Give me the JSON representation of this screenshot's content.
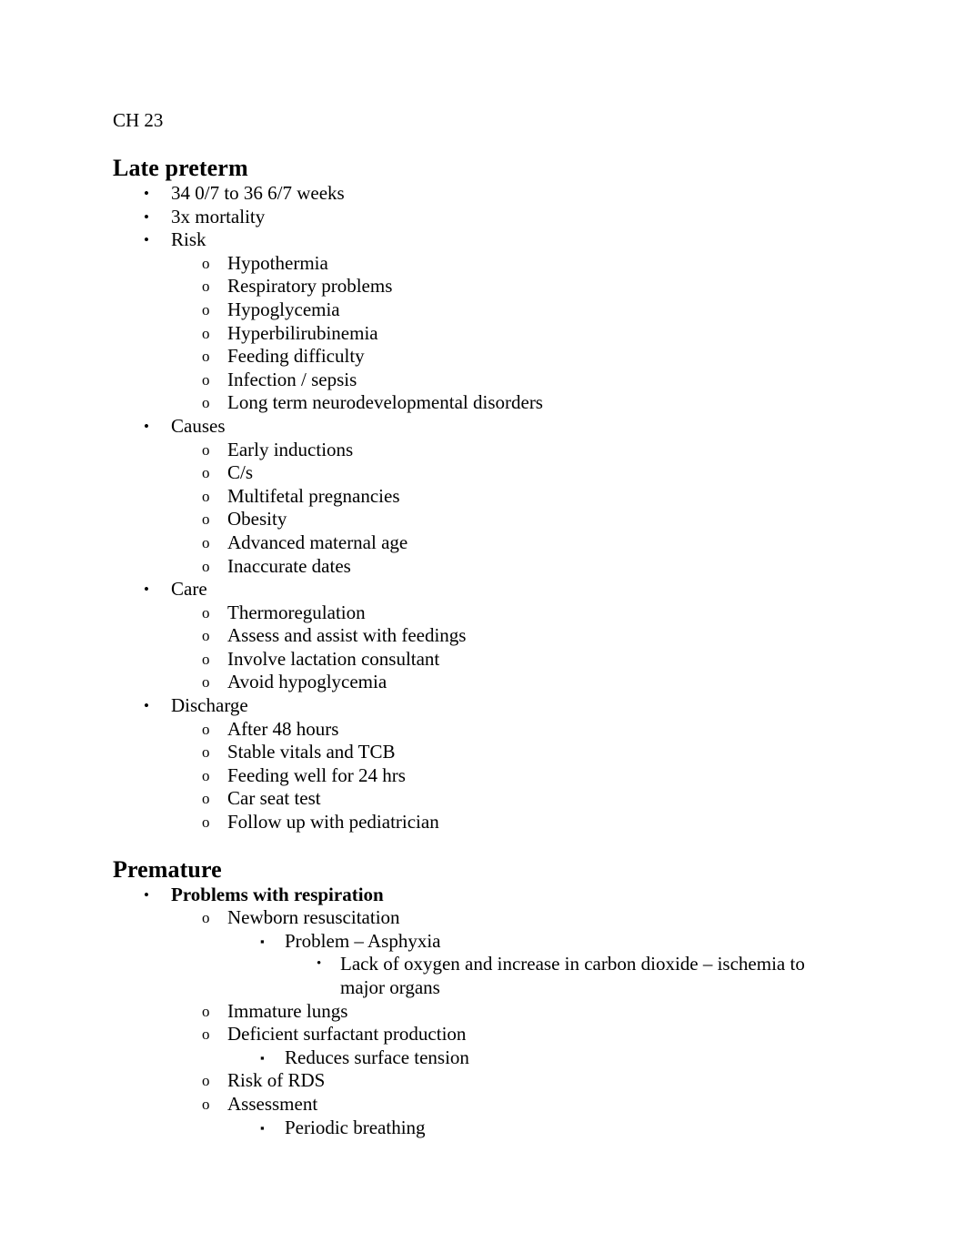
{
  "document": {
    "intro": "CH 23",
    "sections": [
      {
        "heading": "Late preterm",
        "items": [
          {
            "level": 1,
            "bullet": "disc-bullet",
            "text": "34 0/7 to 36 6/7 weeks",
            "bold": false
          },
          {
            "level": 1,
            "bullet": "disc-bullet",
            "text": "3x mortality",
            "bold": false
          },
          {
            "level": 1,
            "bullet": "disc-bullet",
            "text": "Risk",
            "bold": false
          },
          {
            "level": 2,
            "bullet": "circle-bullet",
            "text": "Hypothermia",
            "bold": false
          },
          {
            "level": 2,
            "bullet": "circle-bullet",
            "text": "Respiratory problems",
            "bold": false
          },
          {
            "level": 2,
            "bullet": "circle-bullet",
            "text": "Hypoglycemia",
            "bold": false
          },
          {
            "level": 2,
            "bullet": "circle-bullet",
            "text": "Hyperbilirubinemia",
            "bold": false
          },
          {
            "level": 2,
            "bullet": "circle-bullet",
            "text": "Feeding difficulty",
            "bold": false
          },
          {
            "level": 2,
            "bullet": "circle-bullet",
            "text": "Infection / sepsis",
            "bold": false
          },
          {
            "level": 2,
            "bullet": "circle-bullet",
            "text": "Long term neurodevelopmental disorders",
            "bold": false
          },
          {
            "level": 1,
            "bullet": "disc-bullet",
            "text": "Causes",
            "bold": false
          },
          {
            "level": 2,
            "bullet": "circle-bullet",
            "text": "Early inductions",
            "bold": false
          },
          {
            "level": 2,
            "bullet": "circle-bullet",
            "text": "C/s",
            "bold": false
          },
          {
            "level": 2,
            "bullet": "circle-bullet",
            "text": "Multifetal pregnancies",
            "bold": false
          },
          {
            "level": 2,
            "bullet": "circle-bullet",
            "text": "Obesity",
            "bold": false
          },
          {
            "level": 2,
            "bullet": "circle-bullet",
            "text": "Advanced maternal age",
            "bold": false
          },
          {
            "level": 2,
            "bullet": "circle-bullet",
            "text": "Inaccurate dates",
            "bold": false
          },
          {
            "level": 1,
            "bullet": "disc-bullet",
            "text": "Care",
            "bold": false
          },
          {
            "level": 2,
            "bullet": "circle-bullet",
            "text": "Thermoregulation",
            "bold": false
          },
          {
            "level": 2,
            "bullet": "circle-bullet",
            "text": "Assess and assist with feedings",
            "bold": false
          },
          {
            "level": 2,
            "bullet": "circle-bullet",
            "text": "Involve lactation consultant",
            "bold": false
          },
          {
            "level": 2,
            "bullet": "circle-bullet",
            "text": "Avoid hypoglycemia",
            "bold": false
          },
          {
            "level": 1,
            "bullet": "disc-bullet",
            "text": "Discharge",
            "bold": false
          },
          {
            "level": 2,
            "bullet": "circle-bullet",
            "text": "After 48 hours",
            "bold": false
          },
          {
            "level": 2,
            "bullet": "circle-bullet",
            "text": "Stable vitals and TCB",
            "bold": false
          },
          {
            "level": 2,
            "bullet": "circle-bullet",
            "text": "Feeding well for 24 hrs",
            "bold": false
          },
          {
            "level": 2,
            "bullet": "circle-bullet",
            "text": "Car seat test",
            "bold": false
          },
          {
            "level": 2,
            "bullet": "circle-bullet",
            "text": "Follow up with pediatrician",
            "bold": false
          }
        ]
      },
      {
        "heading": "Premature",
        "items": [
          {
            "level": 1,
            "bullet": "disc-bullet",
            "text": "Problems with respiration",
            "bold": true
          },
          {
            "level": 2,
            "bullet": "circle-bullet",
            "text": "Newborn resuscitation",
            "bold": false
          },
          {
            "level": 3,
            "bullet": "square-bullet",
            "text": "Problem – Asphyxia",
            "bold": false
          },
          {
            "level": 4,
            "bullet": "disc-bullet",
            "text": "Lack of oxygen and increase in carbon dioxide – ischemia to major organs",
            "bold": false
          },
          {
            "level": 2,
            "bullet": "circle-bullet",
            "text": "Immature lungs",
            "bold": false
          },
          {
            "level": 2,
            "bullet": "circle-bullet",
            "text": "Deficient surfactant production",
            "bold": false
          },
          {
            "level": 3,
            "bullet": "square-bullet",
            "text": "Reduces surface tension",
            "bold": false
          },
          {
            "level": 2,
            "bullet": "circle-bullet",
            "text": "Risk of RDS",
            "bold": false
          },
          {
            "level": 2,
            "bullet": "circle-bullet",
            "text": "Assessment",
            "bold": false
          },
          {
            "level": 3,
            "bullet": "square-bullet",
            "text": "Periodic breathing",
            "bold": false
          }
        ]
      }
    ],
    "bullet_glyphs": {
      "disc-bullet": "•",
      "circle-bullet": "o",
      "square-bullet": "▪"
    },
    "colors": {
      "text": "#000000",
      "background": "#ffffff"
    }
  }
}
